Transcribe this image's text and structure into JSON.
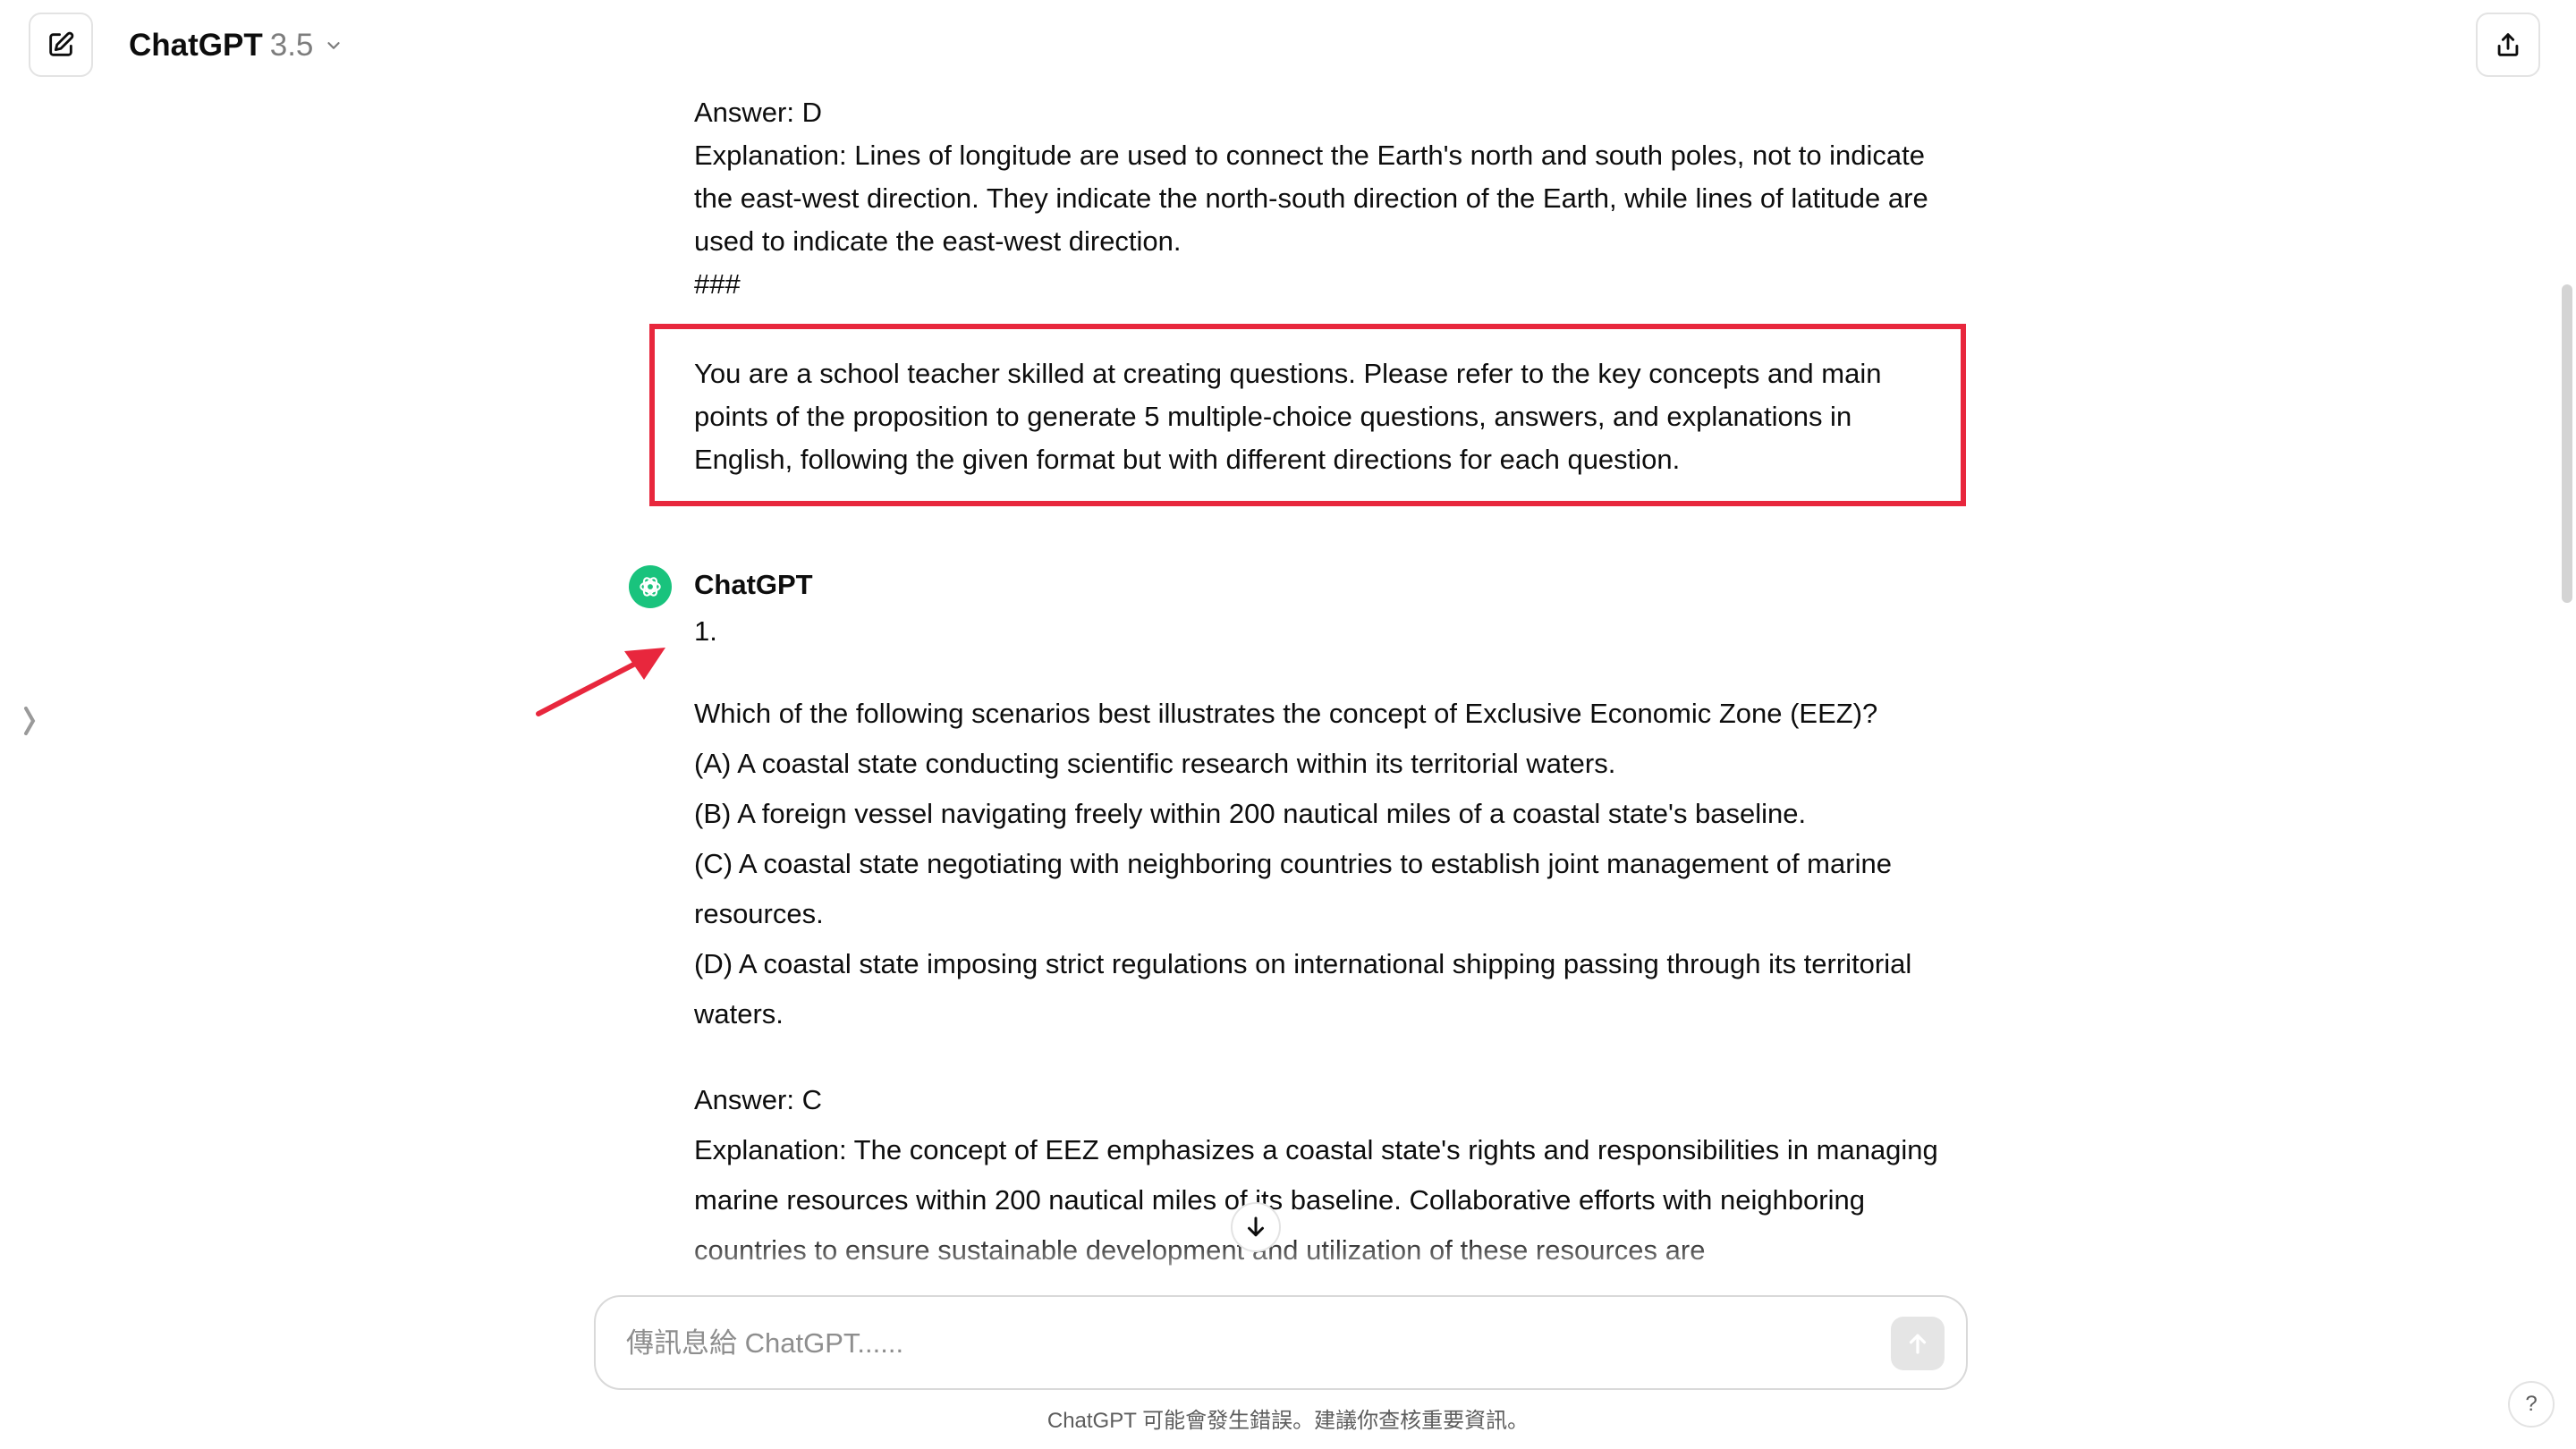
{
  "header": {
    "model_name": "ChatGPT",
    "model_version": "3.5"
  },
  "previous_answer": {
    "answer": "Answer: D",
    "explanation": "Explanation: Lines of longitude are used to connect the Earth's north and south poles, not to indicate the east-west direction. They indicate the north-south direction of the Earth, while lines of latitude are used to indicate the east-west direction.",
    "separator": "###"
  },
  "user_message": {
    "text": "You are a school teacher skilled at creating questions. Please refer to the key concepts and main points of the proposition to generate 5 multiple-choice questions, answers, and explanations in English, following the given format but with different directions for each question."
  },
  "assistant": {
    "author": "ChatGPT",
    "question_number": "1.",
    "question": "Which of the following scenarios best illustrates the concept of Exclusive Economic Zone (EEZ)?",
    "options": [
      "(A) A coastal state conducting scientific research within its territorial waters.",
      "(B) A foreign vessel navigating freely within 200 nautical miles of a coastal state's baseline.",
      "(C) A coastal state negotiating with neighboring countries to establish joint management of marine resources.",
      "(D) A coastal state imposing strict regulations on international shipping passing through its territorial waters."
    ],
    "answer": "Answer: C",
    "explanation": "Explanation: The concept of EEZ emphasizes a coastal state's rights and responsibilities in managing marine resources within 200 nautical miles of its baseline. Collaborative efforts with neighboring countries to ensure sustainable development and utilization of these resources are"
  },
  "composer": {
    "placeholder": "傳訊息給 ChatGPT......"
  },
  "footer": {
    "disclaimer": "ChatGPT 可能會發生錯誤。建議你查核重要資訊。",
    "help": "?"
  },
  "colors": {
    "highlight_border": "#e8273d",
    "annotation_arrow": "#e8273d",
    "avatar_bg": "#19c37d"
  },
  "icons": {
    "new_chat": "pencil-square-icon",
    "model_dropdown": "chevron-down-icon",
    "share": "share-upload-icon",
    "sidebar": "chevron-right-icon",
    "avatar": "openai-logo-icon",
    "scroll_down": "arrow-down-icon",
    "send": "arrow-up-icon"
  }
}
